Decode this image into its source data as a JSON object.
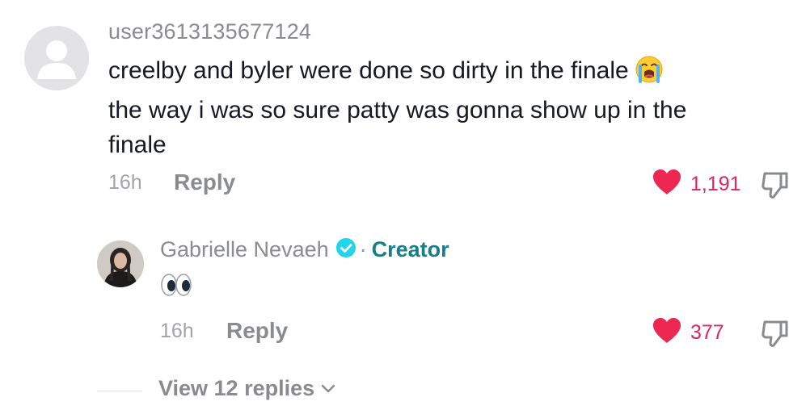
{
  "comment": {
    "username": "user3613135677124",
    "text_line_1": "creelby and byler were done so dirty in the finale",
    "text_line_2": "the way i was so sure patty was gonna show up in the",
    "text_line_3": "finale",
    "emoji": "loudly-crying-face-emoji",
    "time": "16h",
    "reply_label": "Reply",
    "like_count": "1,191",
    "liked": true
  },
  "creator_reply": {
    "name": "Gabrielle Nevaeh",
    "separator": "·",
    "creator_label": "Creator",
    "verified": true,
    "text_emoji": "eyes-emoji",
    "time": "16h",
    "reply_label": "Reply",
    "like_count": "377",
    "liked": true
  },
  "view_replies": {
    "label": "View 12 replies"
  },
  "colors": {
    "like_red": "#e0245e",
    "creator_teal": "#157f8a",
    "verified_blue": "#20d5ec",
    "muted_text": "#8a8b91",
    "body_text": "#161823"
  },
  "icons": {
    "like": "heart-icon",
    "dislike": "thumbs-down-icon",
    "verified": "verified-check-icon",
    "expand": "chevron-down-icon"
  }
}
